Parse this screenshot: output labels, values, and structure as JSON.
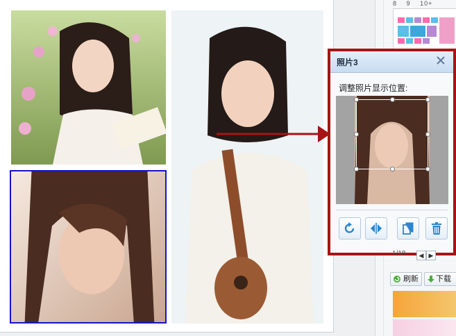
{
  "panel": {
    "title": "照片3",
    "label": "调整照片显示位置:",
    "tools": [
      "rotate-icon",
      "flip-icon",
      "copy-icon",
      "trash-icon"
    ]
  },
  "ruler": [
    "8",
    "9",
    "10+"
  ],
  "pager": {
    "page": "1/18"
  },
  "buttons": {
    "refresh": "刷新",
    "download": "下载"
  },
  "colors": {
    "highlight": "#a61416",
    "selection": "#1414c8"
  }
}
